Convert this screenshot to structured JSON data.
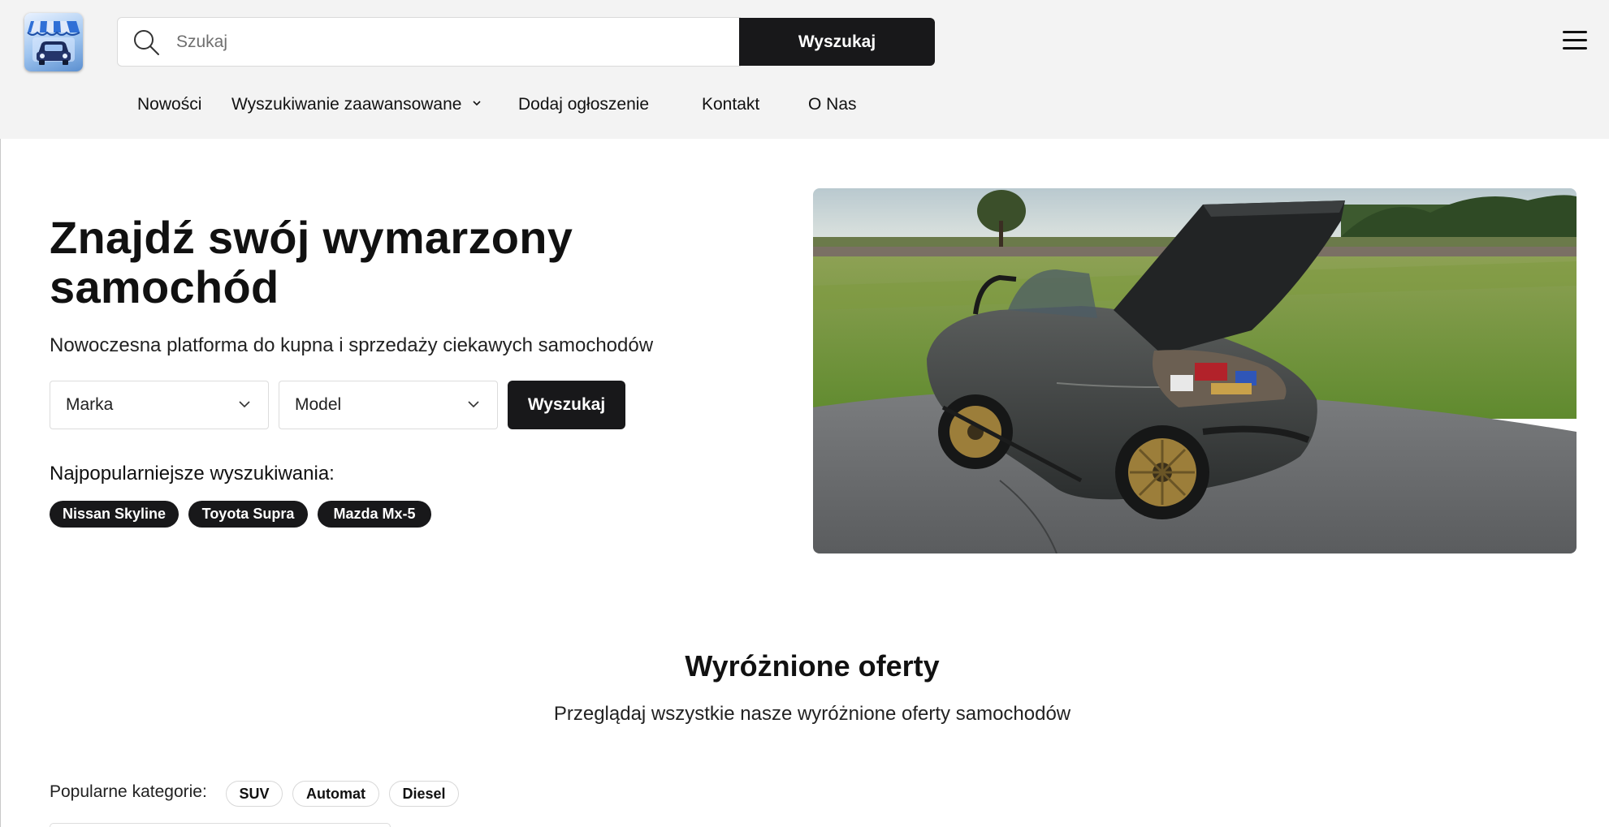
{
  "header": {
    "logo": {
      "icon": "car-shop-logo-icon"
    },
    "search": {
      "placeholder": "Szukaj",
      "value": "",
      "button_label": "Wyszukaj",
      "icon": "search-icon"
    },
    "menu_icon": "hamburger-menu-icon",
    "nav": [
      {
        "label": "Nowości"
      },
      {
        "label": "Wyszukiwanie zaawansowane",
        "icon": "chevron-down-icon"
      },
      {
        "label": "Dodaj ogłoszenie"
      },
      {
        "label": "Kontakt"
      },
      {
        "label": "O Nas"
      }
    ]
  },
  "hero": {
    "title": "Znajdź swój wymarzony samochód",
    "subtitle": "Nowoczesna platforma do kupna i sprzedaży ciekawych samochodów",
    "brand_select": {
      "value": "Marka"
    },
    "model_select": {
      "value": "Model"
    },
    "search_button": "Wyszukaj",
    "popular_title": "Najpopularniejsze wyszukiwania:",
    "popular_tags": [
      "Nissan Skyline",
      "Toyota Supra",
      "Mazda Mx-5"
    ]
  },
  "featured": {
    "title": "Wyróżnione oferty",
    "subtitle": "Przeglądaj wszystkie nasze wyróżnione oferty samochodów"
  },
  "categories": {
    "label": "Popularne kategorie:",
    "items": [
      "SUV",
      "Automat",
      "Diesel"
    ]
  },
  "colors": {
    "primary_dark": "#18181a",
    "header_bg": "#f3f3f3",
    "page_bg": "#ffffff"
  }
}
